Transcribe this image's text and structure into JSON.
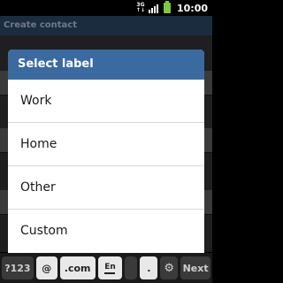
{
  "status_bar": {
    "network": [
      "3G",
      "↑↓"
    ],
    "time": "10:00"
  },
  "app": {
    "title": "Create contact"
  },
  "dialog": {
    "title": "Select label",
    "options": [
      "Work",
      "Home",
      "Other",
      "Custom"
    ]
  },
  "keyboard": {
    "symbols_key": "?123",
    "at_key": "@",
    "dotcom_key": ".com",
    "lang_key": "En",
    "period_key": ".",
    "settings_icon": "gear-icon",
    "next_key": "Next"
  }
}
